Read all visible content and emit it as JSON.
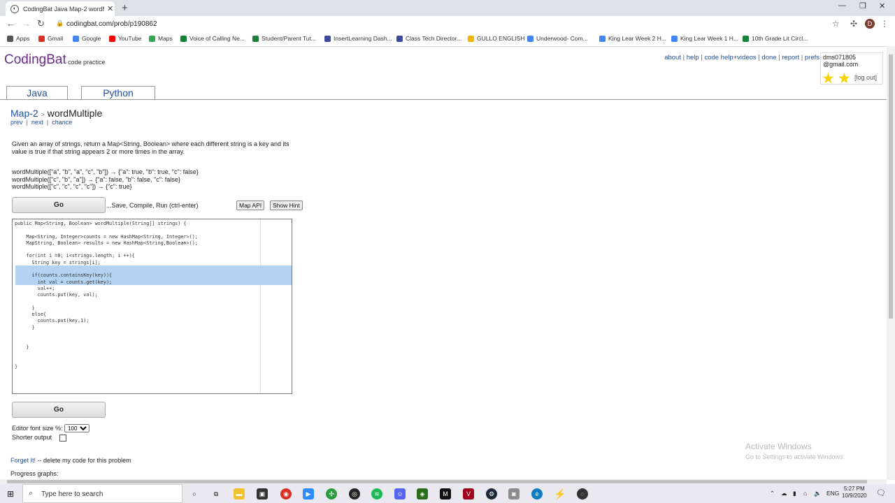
{
  "browser": {
    "tab_title": "CodingBat Java Map-2 wordMultiple",
    "url": "codingbat.com/prob/p190862",
    "new_tab": "+",
    "profile_initial": "D"
  },
  "bookmarks": [
    {
      "label": "Apps",
      "color": "#555555"
    },
    {
      "label": "Gmail",
      "color": "#d93025"
    },
    {
      "label": "Google",
      "color": "#4285f4"
    },
    {
      "label": "YouTube",
      "color": "#ff0000"
    },
    {
      "label": "Maps",
      "color": "#34a853"
    },
    {
      "label": "Voice of Calling Ne...",
      "color": "#188038"
    },
    {
      "label": "Student/Parent Tut...",
      "color": "#188038"
    },
    {
      "label": "InsertLearning Dash...",
      "color": "#3c4a9e"
    },
    {
      "label": "Class Tech Director...",
      "color": "#3c4a9e"
    },
    {
      "label": "GULLO ENGLISH",
      "color": "#f4b400"
    },
    {
      "label": "Underwood- Com...",
      "color": "#4285f4"
    },
    {
      "label": "King Lear Week 2 H...",
      "color": "#4285f4"
    },
    {
      "label": "King Lear Week 1 H...",
      "color": "#4285f4"
    },
    {
      "label": "10th Grade Lit Circl...",
      "color": "#188038"
    }
  ],
  "site": {
    "logo": "CodingBat",
    "logo_sub": "code practice",
    "toplinks": [
      "about",
      "help",
      "code help+videos",
      "done",
      "report",
      "prefs"
    ],
    "user_line1": "dms071805",
    "user_line2": "@gmail.com",
    "logout": "[log out]",
    "tabs": [
      "Java",
      "Python"
    ]
  },
  "problem": {
    "section": "Map-2",
    "name": "wordMultiple",
    "nav": [
      "prev",
      "next",
      "chance"
    ],
    "description": "Given an array of strings, return a Map<String, Boolean> where each different string is a key and its value is true if that string appears 2 or more times in the array.",
    "examples": [
      "wordMultiple([\"a\", \"b\", \"a\", \"c\", \"b\"]) → {\"a\": true, \"b\": true, \"c\": false}",
      "wordMultiple([\"c\", \"b\", \"a\"]) → {\"a\": false, \"b\": false, \"c\": false}",
      "wordMultiple([\"c\", \"c\", \"c\", \"c\"]) → {\"c\": true}"
    ],
    "go_label": "Go",
    "save_hint": "...Save, Compile, Run (ctrl-enter)",
    "map_api": "Map API",
    "show_hint": "Show Hint"
  },
  "editor": {
    "lines": [
      "public Map<String, Boolean> wordMultiple(String[] strings) {",
      "",
      "    Map<String, Integer>counts = new HashMap<String, Integer>();",
      "    MapString, Boolean> results = new HashMap<String,Boolean>();",
      "",
      "    for(int i =0; i<strings.length; i ++){",
      "      String key = strings[i];",
      "",
      "      if(counts.containsKey(key)){",
      "        int val = counts.get(key);",
      "        val++;",
      "        counts.put(key, val);",
      "",
      "      }",
      "      else{",
      "        counts.put(key,1);",
      "      }",
      "",
      "",
      "    }",
      "",
      "",
      "}"
    ]
  },
  "options": {
    "font_size_label": "Editor font size %:",
    "font_size_value": "100",
    "shorter_output": "Shorter output",
    "forget_link": "Forget It!",
    "forget_text": " -- delete my code for this problem",
    "progress": "Progress graphs:"
  },
  "watermark": {
    "line1": "Activate Windows",
    "line2": "Go to Settings to activate Windows."
  },
  "taskbar": {
    "search_placeholder": "Type here to search",
    "lang": "ENG",
    "time": "5:27 PM",
    "date": "10/9/2020"
  }
}
